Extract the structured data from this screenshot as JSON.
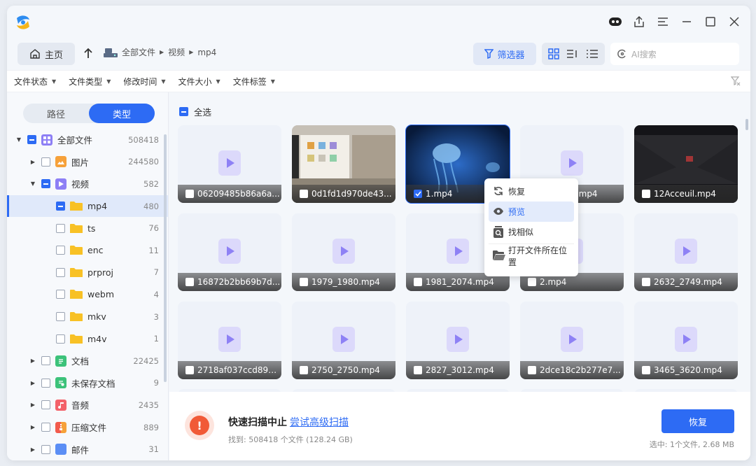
{
  "toolbar": {
    "home_label": "主页",
    "breadcrumb": [
      "全部文件",
      "视频",
      "mp4"
    ],
    "filter_label": "筛选器",
    "search_placeholder": "AI搜索"
  },
  "filters": [
    "文件状态",
    "文件类型",
    "修改时间",
    "文件大小",
    "文件标签"
  ],
  "sidebar": {
    "tabs": [
      "路径",
      "类型"
    ],
    "active_tab": "类型",
    "tree": [
      {
        "label": "全部文件",
        "count": "508418"
      },
      {
        "label": "图片",
        "count": "244580"
      },
      {
        "label": "视频",
        "count": "582"
      },
      {
        "label": "mp4",
        "count": "480"
      },
      {
        "label": "ts",
        "count": "76"
      },
      {
        "label": "enc",
        "count": "11"
      },
      {
        "label": "prproj",
        "count": "7"
      },
      {
        "label": "webm",
        "count": "4"
      },
      {
        "label": "mkv",
        "count": "3"
      },
      {
        "label": "m4v",
        "count": "1"
      },
      {
        "label": "文档",
        "count": "22425"
      },
      {
        "label": "未保存文档",
        "count": "9"
      },
      {
        "label": "音频",
        "count": "2435"
      },
      {
        "label": "压缩文件",
        "count": "889"
      },
      {
        "label": "邮件",
        "count": "31"
      }
    ]
  },
  "main": {
    "select_all_label": "全选",
    "files": [
      "06209485b86a6a...",
      "0d1fd1d970de43...",
      "1.mp4",
      "10_1138.mp4",
      "12Acceuil.mp4",
      "16872b2bb69b7d...",
      "1979_1980.mp4",
      "1981_2074.mp4",
      "2.mp4",
      "2632_2749.mp4",
      "2718af037ccd891...",
      "2750_2750.mp4",
      "2827_3012.mp4",
      "2dce18c2b277e7...",
      "3465_3620.mp4"
    ]
  },
  "context_menu": {
    "items": [
      "恢复",
      "预览",
      "找相似",
      "打开文件所在位置"
    ],
    "highlighted": "预览"
  },
  "status": {
    "title": "快速扫描中止",
    "link": "尝试高级扫描",
    "found": "找到: 508418 个文件 (128.24 GB)",
    "recover_label": "恢复",
    "selection": "选中: 1个文件, 2.68 MB"
  },
  "colors": {
    "accent": "#2d6bf4",
    "warning": "#f15a37"
  }
}
